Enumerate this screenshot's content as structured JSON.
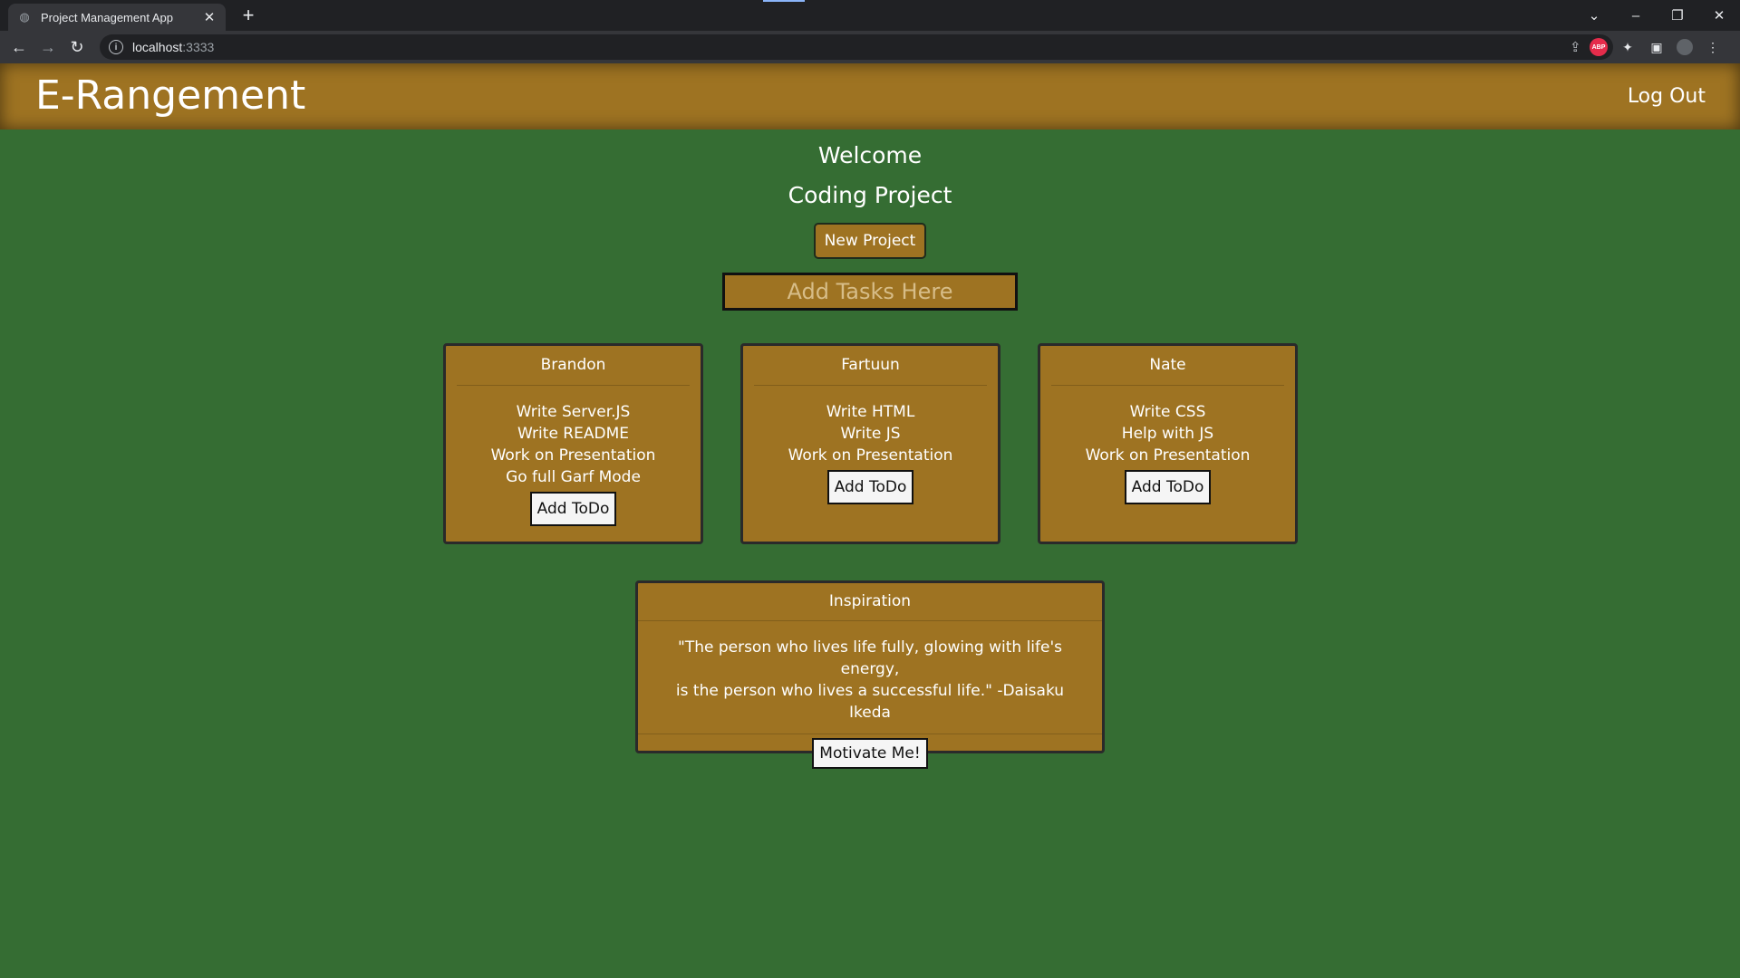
{
  "browser": {
    "tab_title": "Project Management App",
    "url_host": "localhost",
    "url_port": ":3333"
  },
  "header": {
    "title": "E-Rangement",
    "logout_label": "Log Out"
  },
  "main": {
    "welcome": "Welcome",
    "project_name": "Coding Project",
    "new_project_label": "New Project",
    "task_placeholder": "Add Tasks Here"
  },
  "members": [
    {
      "name": "Brandon",
      "tasks": [
        "Write Server.JS",
        "Write README",
        "Work on Presentation",
        "Go full Garf Mode"
      ],
      "button": "Add ToDo"
    },
    {
      "name": "Fartuun",
      "tasks": [
        "Write HTML",
        "Write JS",
        "Work on Presentation"
      ],
      "button": "Add ToDo"
    },
    {
      "name": "Nate",
      "tasks": [
        "Write CSS",
        "Help with JS",
        "Work on Presentation"
      ],
      "button": "Add ToDo"
    }
  ],
  "inspiration": {
    "title": "Inspiration",
    "quote_line1": "\"The person who lives life fully, glowing with life's energy,",
    "quote_line2": "is the person who lives a successful life.\" -Daisaku Ikeda",
    "button": "Motivate Me!"
  },
  "colors": {
    "background": "#356d33",
    "panel": "#9e7322"
  }
}
